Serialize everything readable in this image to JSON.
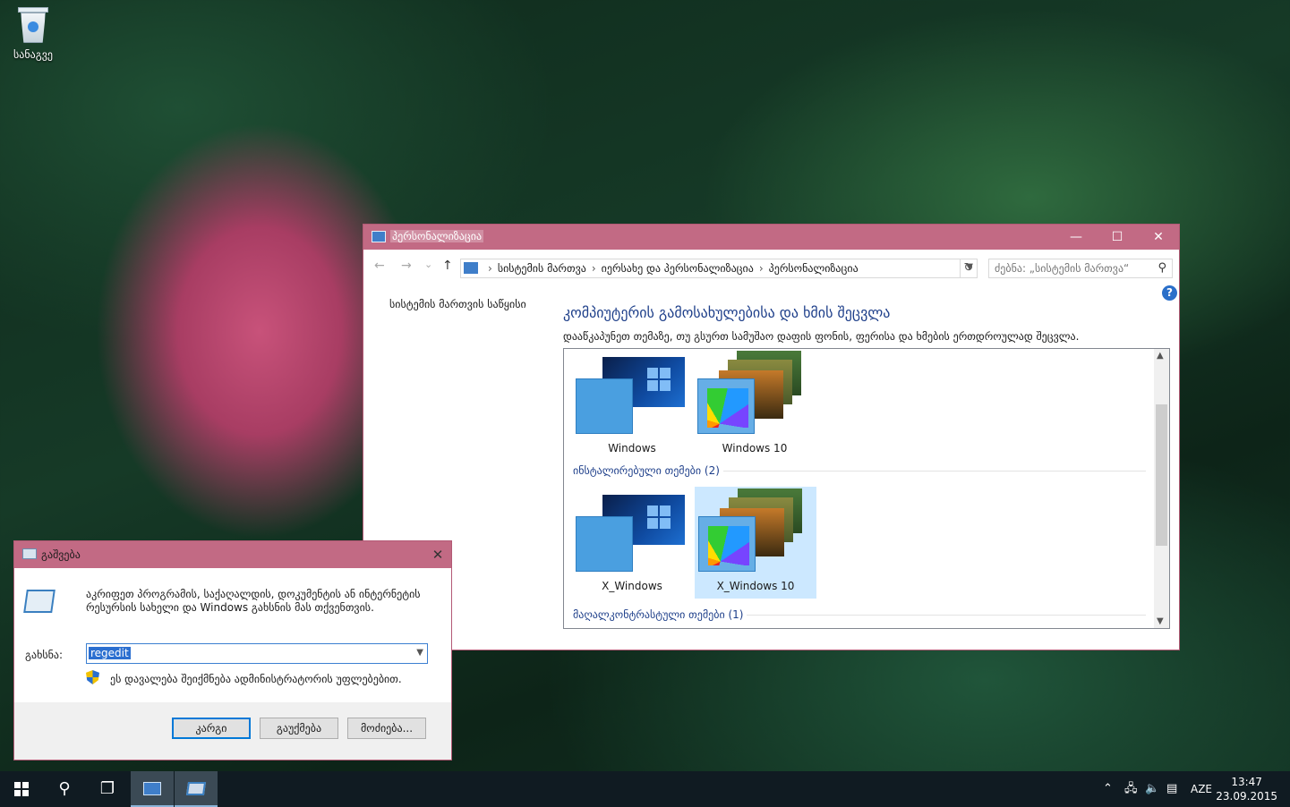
{
  "desktop": {
    "recycle_bin_label": "სანაგვე"
  },
  "personalization": {
    "title": "პერსონალიზაცია",
    "window_controls": {
      "minimize": "—",
      "maximize": "☐",
      "close": "✕"
    },
    "nav": {
      "back": "←",
      "forward": "→",
      "recent": "⌄",
      "up": "↑"
    },
    "breadcrumbs": [
      "სისტემის მართვა",
      "იერსახე და პერსონალიზაცია",
      "პერსონალიზაცია"
    ],
    "breadcrumb_separator": "›",
    "refresh": "↻",
    "search_placeholder": "ძებნა: „სისტემის მართვა“",
    "help": "?",
    "sidebar_link": "სისტემის მართვის საწყისი",
    "heading": "კომპიუტერის გამოსახულებისა და ხმის შეცვლა",
    "description": "დააწკაპუნეთ თემაზე, თუ გსურთ სამუშაო დაფის ფონის, ფერისა და ხმების ერთდროულად შეცვლა.",
    "themes_top": [
      {
        "name": "Windows",
        "thumb": "windows-theme"
      },
      {
        "name": "Windows 10",
        "thumb": "windows10-theme"
      }
    ],
    "installed_group_label": "ინსტალირებული თემები (2)",
    "themes_installed": [
      {
        "name": "X_Windows",
        "thumb": "windows-theme",
        "selected": false
      },
      {
        "name": "X_Windows 10",
        "thumb": "windows10-theme",
        "selected": true
      }
    ],
    "high_contrast_group_label": "მაღალკონტრასტული თემები (1)"
  },
  "run_dialog": {
    "title": "გაშვება",
    "close": "✕",
    "description": "აკრიფეთ პროგრამის, საქაღალდის, დოკუმენტის ან ინტერნეტის რესურსის სახელი და Windows გახსნის მას თქვენთვის.",
    "open_label": "გახსნა:",
    "open_value": "regedit",
    "admin_note": "ეს დავალება შეიქმნება ადმინისტრატორის უფლებებით.",
    "buttons": {
      "ok": "კარგი",
      "cancel": "გაუქმება",
      "browse": "მოძიება..."
    }
  },
  "taskbar": {
    "language": "AZE",
    "time": "13:47",
    "date": "23.09.2015"
  },
  "colors": {
    "titlebar": "#c26a84",
    "accent_blue": "#0078d7",
    "heading_blue": "#1e3f8a",
    "taskbar": "#101b22",
    "selection": "#cce8ff"
  }
}
